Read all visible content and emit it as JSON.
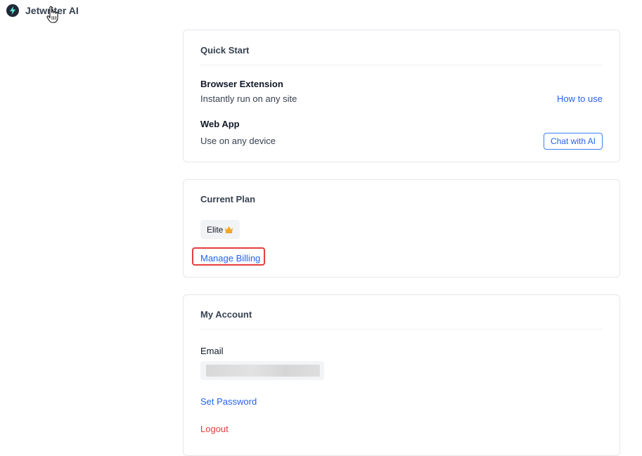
{
  "app": {
    "name": "Jetwriter AI",
    "logo_icon": "lightning-bolt-icon"
  },
  "quick_start": {
    "title": "Quick Start",
    "browser_extension": {
      "label": "Browser Extension",
      "description": "Instantly run on any site",
      "link_label": "How to use"
    },
    "web_app": {
      "label": "Web App",
      "description": "Use on any device",
      "button_label": "Chat with AI"
    }
  },
  "current_plan": {
    "title": "Current Plan",
    "plan_name": "Elite",
    "plan_icon": "crown-icon",
    "manage_billing_label": "Manage Billing"
  },
  "my_account": {
    "title": "My Account",
    "email_label": "Email",
    "set_password_label": "Set Password",
    "logout_label": "Logout"
  },
  "colors": {
    "link": "#2563eb",
    "danger": "#e53e3e",
    "crown": "#f5a623",
    "highlight": "#e53e3e"
  }
}
